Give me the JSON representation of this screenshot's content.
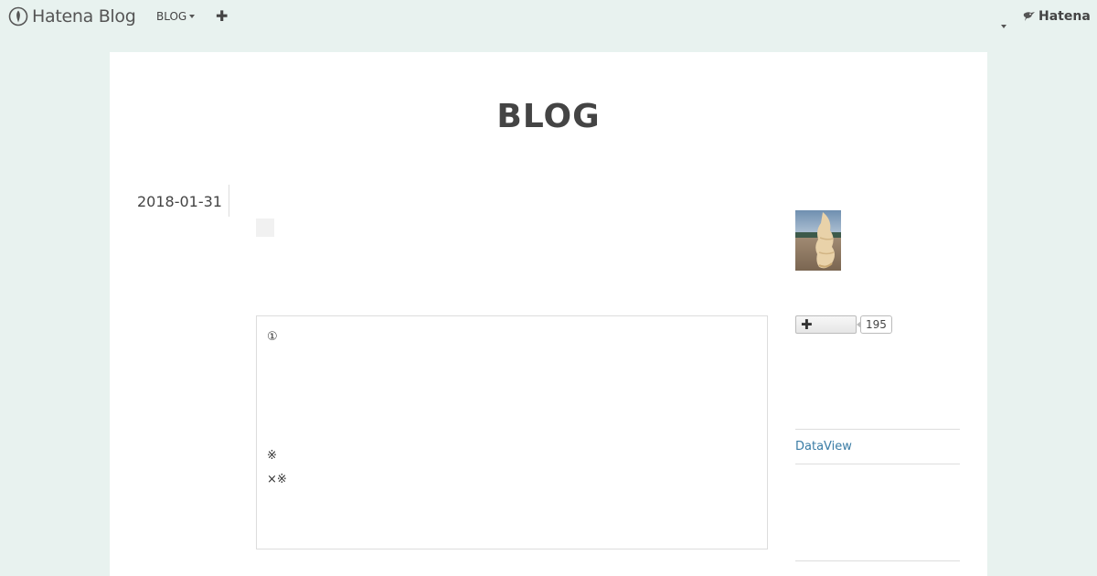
{
  "global_header": {
    "logo_text": "Hatena Blog",
    "blog_menu_label": "BLOG",
    "add_label": "✚",
    "hatena_text": "Hatena"
  },
  "blog": {
    "title": "BLOG"
  },
  "entry": {
    "date": "2018-01-31",
    "content_lines": [
      "①",
      "※",
      "×※"
    ]
  },
  "sidebar": {
    "bookmark_count": "195",
    "links": [
      "DataView"
    ]
  },
  "colors": {
    "background": "#e8f2ef",
    "link": "#3a7ca5",
    "title": "#444444"
  }
}
